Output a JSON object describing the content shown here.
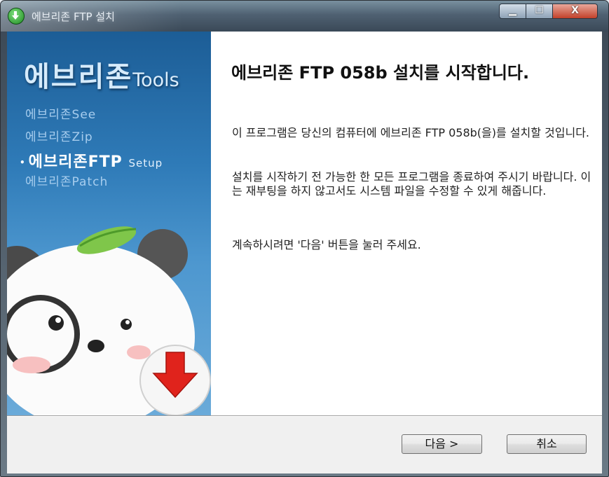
{
  "window": {
    "title": "에브리존 FTP 설치",
    "controls": {
      "minimize": "▁",
      "maximize": "☐",
      "close": "X"
    }
  },
  "sidebar": {
    "brand_main": "에브리존",
    "brand_tools": "Tools",
    "items": [
      {
        "label": "에브리존See",
        "active": false
      },
      {
        "label": "에브리존Zip",
        "active": false
      },
      {
        "label": "에브리존FTP",
        "suffix": "Setup",
        "active": true
      },
      {
        "label": "에브리존Patch",
        "active": false
      }
    ]
  },
  "content": {
    "heading": "에브리존 FTP 058b 설치를 시작합니다.",
    "paragraph1": "이 프로그램은 당신의 컴퓨터에 에브리존 FTP 058b(을)를 설치할 것입니다.",
    "paragraph2": "설치를 시작하기 전 가능한 한 모든 프로그램을 종료하여 주시기 바랍니다. 이는 재부팅을 하지 않고서도 시스템 파일을 수정할 수 있게 해줍니다.",
    "paragraph3": "계속하시려면 '다음' 버튼을 눌러 주세요."
  },
  "buttons": {
    "next": "다음 >",
    "cancel": "취소"
  },
  "colors": {
    "sidebar_top": "#1c5d96",
    "sidebar_bottom": "#6aaad9",
    "install_arrow": "#e0231c"
  }
}
